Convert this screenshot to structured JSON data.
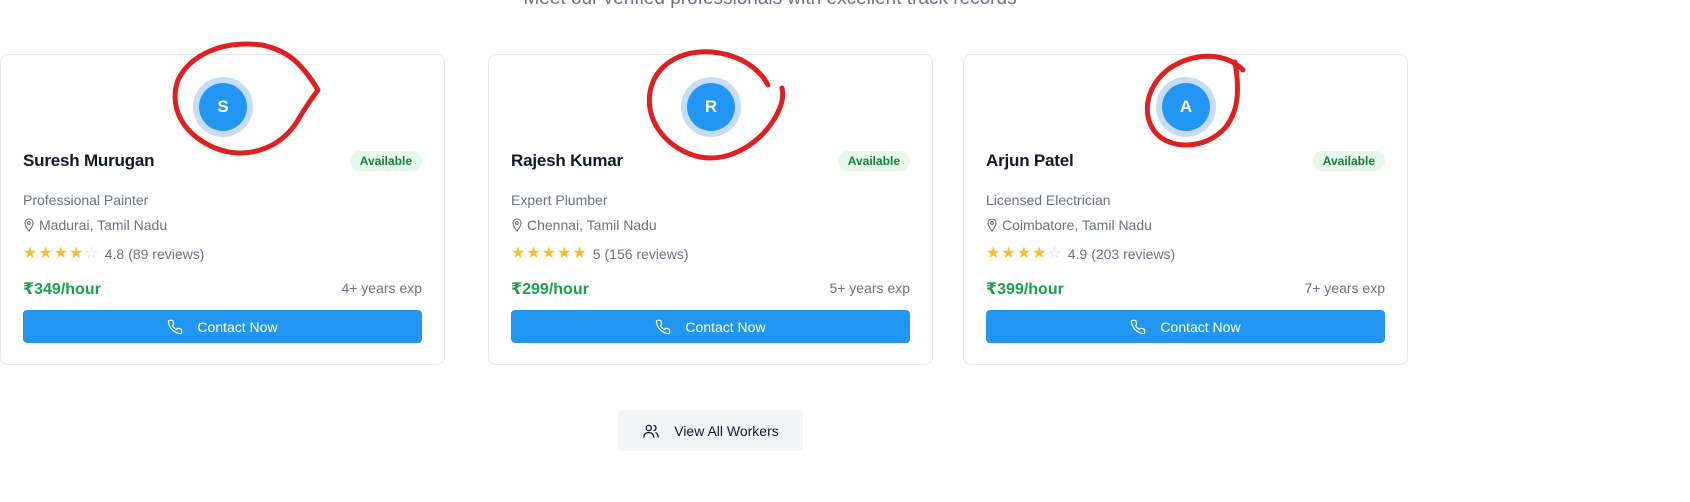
{
  "section": {
    "subtitle": "Meet our verified professionals with excellent track records"
  },
  "workers": [
    {
      "initial": "R",
      "name": "Rajesh Kumar",
      "status": "Available",
      "profession": "Expert Plumber",
      "location": "Chennai, Tamil Nadu",
      "rating": "5",
      "rating_value": 5,
      "reviews": "(156 reviews)",
      "price": "₹299/hour",
      "experience": "5+ years exp",
      "cta": "Contact Now"
    },
    {
      "initial": "A",
      "name": "Arjun Patel",
      "status": "Available",
      "profession": "Licensed Electrician",
      "location": "Coimbatore, Tamil Nadu",
      "rating": "4.9",
      "rating_value": 4.9,
      "reviews": "(203 reviews)",
      "price": "₹399/hour",
      "experience": "7+ years exp",
      "cta": "Contact Now"
    },
    {
      "initial": "S",
      "name": "Suresh Murugan",
      "status": "Available",
      "profession": "Professional Painter",
      "location": "Madurai, Tamil Nadu",
      "rating": "4.8",
      "rating_value": 4.8,
      "reviews": "(89 reviews)",
      "price": "₹349/hour",
      "experience": "4+ years exp",
      "cta": "Contact Now"
    }
  ],
  "view_all": {
    "label": "View All Workers",
    "icon": "users-icon"
  },
  "icons": {
    "location": "map-pin-icon",
    "star": "star-icon",
    "contact": "phone-icon"
  },
  "colors": {
    "accent": "#2196f3",
    "price": "#16a34a",
    "star": "#fbbf24",
    "badge_bg": "#e6f7ec",
    "annotation": "#e02020"
  }
}
